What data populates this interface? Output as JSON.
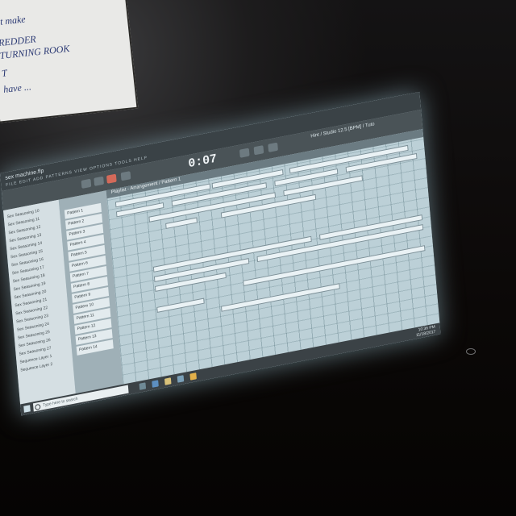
{
  "notes": {
    "lines": [
      "st make",
      "REDDER",
      "TURNING ROOK",
      "T",
      "have ..."
    ]
  },
  "app": {
    "title": "sex machine.flp",
    "menu": "FILE EDIT ADD PATTERNS VIEW OPTIONS TOOLS HELP",
    "time": "0:07",
    "hint": "Hint / Studio 12.5 [BPM] / Tuto",
    "playlist_title": "Playlist - Arrangement / Pattern 1"
  },
  "browser": {
    "items": [
      "Sex Seasoning 10",
      "Sex Seasoning 11",
      "Sex Seasoning 12",
      "Sex Seasoning 13",
      "Sex Seasoning 14",
      "Sex Seasoning 15",
      "Sex Seasoning 16",
      "Sex Seasoning 17",
      "Sex Seasoning 18",
      "Sex Seasoning 19",
      "Sex Seasoning 20",
      "Sex Seasoning 21",
      "Sex Seasoning 22",
      "Sex Seasoning 23",
      "Sex Seasoning 24",
      "Sex Seasoning 25",
      "Sex Seasoning 26",
      "Sex Seasoning 27",
      "Sequence Layer 1",
      "Sequence Layer 2"
    ]
  },
  "patterns": {
    "items": [
      "Pattern 1",
      "Pattern 2",
      "Pattern 3",
      "Pattern 4",
      "Pattern 5",
      "Pattern 6",
      "Pattern 7",
      "Pattern 8",
      "Pattern 9",
      "Pattern 10",
      "Pattern 11",
      "Pattern 12",
      "Pattern 13",
      "Pattern 14"
    ]
  },
  "taskbar": {
    "search_placeholder": "Type here to search",
    "time": "10:36 PM",
    "date": "11/18/2017"
  }
}
